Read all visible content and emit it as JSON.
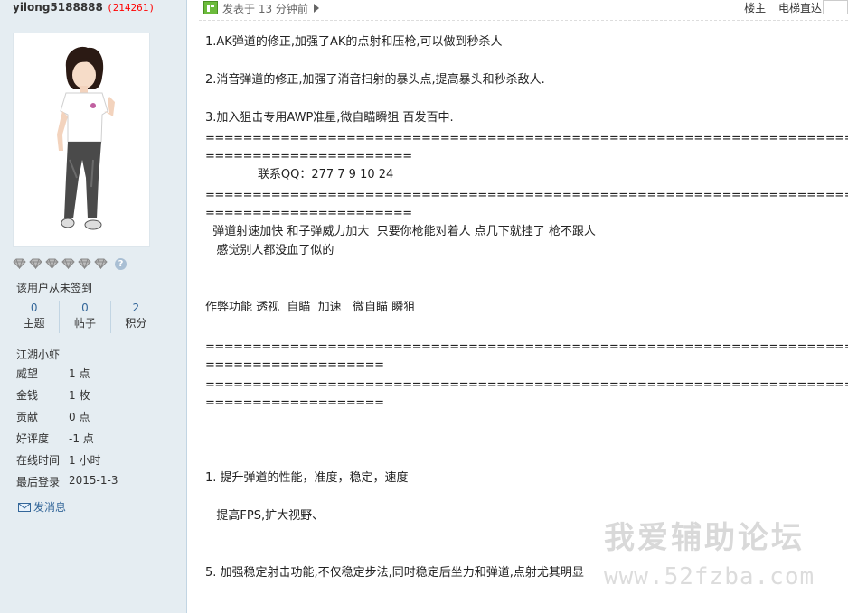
{
  "user": {
    "name": "yilong5188888",
    "uid": "214261",
    "signin_text": "该用户从未签到",
    "stats": [
      {
        "value": "0",
        "label": "主题"
      },
      {
        "value": "0",
        "label": "帖子"
      },
      {
        "value": "2",
        "label": "积分"
      }
    ],
    "rank": "江湖小虾",
    "help_icon": "?",
    "info": [
      {
        "key": "威望",
        "value": "1 点"
      },
      {
        "key": "金钱",
        "value": "1 枚"
      },
      {
        "key": "贡献",
        "value": "0 点"
      },
      {
        "key": "好评度",
        "value": "-1 点"
      },
      {
        "key": "在线时间",
        "value": "1 小时"
      },
      {
        "key": "最后登录",
        "value": "2015-1-3"
      }
    ],
    "pm_label": "发消息"
  },
  "post_header": {
    "posted_text": "发表于 13 分钟前",
    "floor_label": "楼主",
    "jump_label": "电梯直达"
  },
  "post": {
    "l1": "1.AK弹道的修正,加强了AK的点射和压枪,可以做到秒杀人",
    "l2": "2.消音弹道的修正,加强了消音扫射的暴头点,提高暴头和秒杀敌人.",
    "l3": "3.加入狙击专用AWP准星,微自瞄瞬狙 百发百中.",
    "eq_long": "================================================================================================",
    "eq_short1": "======================",
    "qq": "              联系QQ：277 7 9 10 24",
    "eq_short2": "======================",
    "l4": "  弹道射速加快 和子弹威力加大  只要你枪能对着人 点几下就挂了 枪不跟人",
    "l5": "   感觉别人都没血了似的",
    "l6": "作弊功能 透视  自瞄  加速   微自瞄 瞬狙",
    "eq_short3": "===================",
    "eq_short4": "===================",
    "l7": "1. 提升弹道的性能，准度，稳定，速度",
    "l8": "   提高FPS,扩大视野、",
    "l9": "5. 加强稳定射击功能,不仅稳定步法,同时稳定后坐力和弹道,点射尤其明显"
  },
  "watermark": {
    "title": "我爱辅助论坛",
    "url": "www.52fzba.com"
  }
}
